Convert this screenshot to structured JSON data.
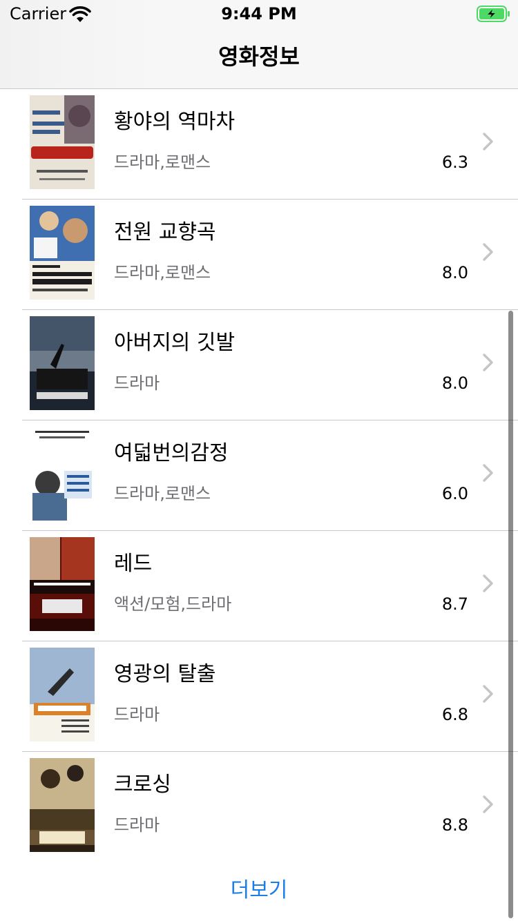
{
  "status_bar": {
    "carrier": "Carrier",
    "time": "9:44 PM",
    "battery_state": "charging"
  },
  "nav": {
    "title": "영화정보"
  },
  "movies": [
    {
      "title": "황야의 역마차",
      "genre": "드라마,로맨스",
      "rating": "6.3"
    },
    {
      "title": "전원 교향곡",
      "genre": "드라마,로맨스",
      "rating": "8.0"
    },
    {
      "title": "아버지의 깃발",
      "genre": "드라마",
      "rating": "8.0"
    },
    {
      "title": "여덟번의감정",
      "genre": "드라마,로맨스",
      "rating": "6.0"
    },
    {
      "title": "레드",
      "genre": "액션/모험,드라마",
      "rating": "8.7"
    },
    {
      "title": "영광의 탈출",
      "genre": "드라마",
      "rating": "6.8"
    },
    {
      "title": "크로싱",
      "genre": "드라마",
      "rating": "8.8"
    }
  ],
  "more_button": {
    "label": "더보기"
  },
  "colors": {
    "accent": "#1a7ee8",
    "separator": "#c8c7cc",
    "secondary_text": "#6d6d72",
    "battery_green": "#4cd964"
  },
  "icons": {
    "wifi": "wifi-icon",
    "battery": "battery-charging-icon",
    "chevron": "chevron-right-icon"
  }
}
